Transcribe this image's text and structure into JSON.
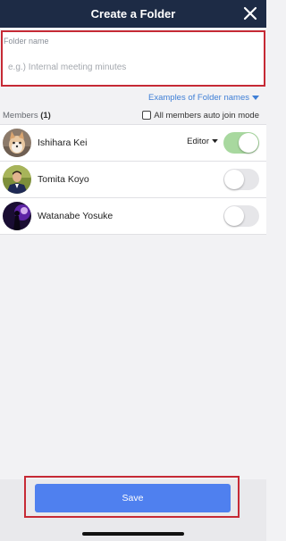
{
  "header": {
    "title": "Create a Folder",
    "close_icon": "close-icon"
  },
  "folder": {
    "label": "Folder name",
    "placeholder": "e.g.) Internal meeting minutes",
    "value": ""
  },
  "examples_link": {
    "label": "Examples of Folder names",
    "icon": "caret-down-icon"
  },
  "members": {
    "label": "Members",
    "count": "(1)",
    "auto_join_label": "All members auto join mode",
    "auto_join_checked": false,
    "list": [
      {
        "name": "Ishihara Kei",
        "role": "Editor",
        "toggle_on": true
      },
      {
        "name": "Tomita Koyo",
        "role": "",
        "toggle_on": false
      },
      {
        "name": "Watanabe Yosuke",
        "role": "",
        "toggle_on": false
      }
    ]
  },
  "footer": {
    "save_label": "Save"
  },
  "colors": {
    "header_bg": "#1d2b45",
    "accent_blue": "#4f80ef",
    "link_blue": "#3f7fd6",
    "toggle_on": "#a8d89f",
    "highlight_red": "#c62a35"
  }
}
